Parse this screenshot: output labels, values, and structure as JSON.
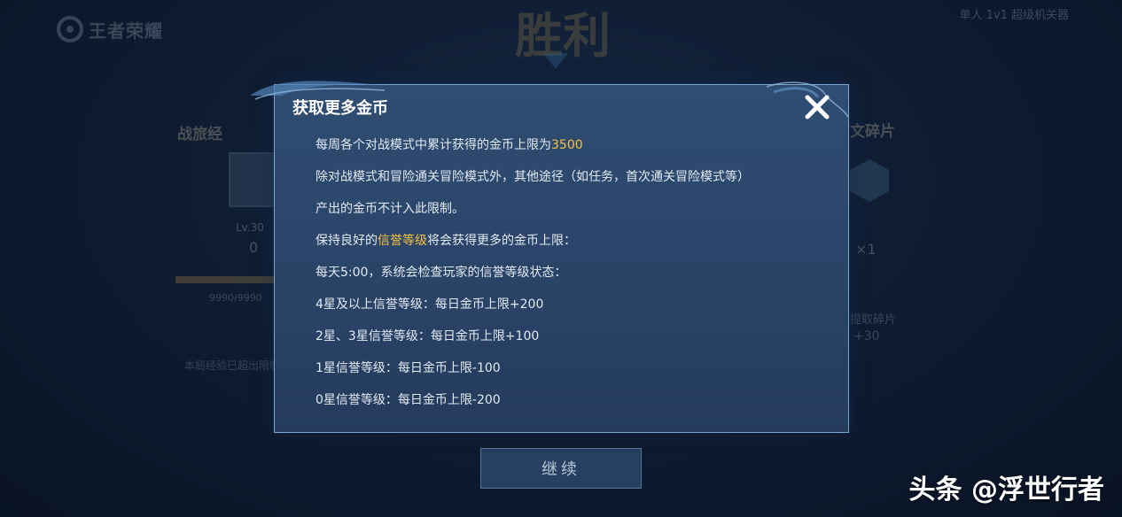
{
  "header": {
    "logo_text": "王者荣耀",
    "victory_text": "胜利",
    "mode_label": "单人 1v1 超级机关器"
  },
  "left_panel": {
    "title": "战旅经",
    "level": "Lv.30",
    "count": "0",
    "exp": "9990/9990",
    "note": "本局经验已超出限制"
  },
  "right_panel": {
    "title": "文碎片",
    "count": "×1",
    "sub_label": "提取碎片",
    "sub_value": "+30"
  },
  "dialog": {
    "title": "获取更多金币",
    "lines": {
      "l1_prefix": "每周各个对战模式中累计获得的金币上限为",
      "l1_value": "3500",
      "l2": "除对战模式和冒险通关冒险模式外，其他途径（如任务，首次通关冒险模式等）",
      "l3": "产出的金币不计入此限制。",
      "l4_prefix": "保持良好的",
      "l4_highlight": "信誉等级",
      "l4_suffix": "将会获得更多的金币上限：",
      "l5": "每天5:00，系统会检查玩家的信誉等级状态：",
      "l6": "4星及以上信誉等级：每日金币上限+200",
      "l7": "2星、3星信誉等级：每日金币上限+100",
      "l8": "1星信誉等级：每日金币上限-100",
      "l9": "0星信誉等级：每日金币上限-200"
    }
  },
  "continue_label": "继续",
  "watermark": "头条 @浮世行者",
  "colors": {
    "highlight": "#f5c242",
    "dialog_border": "#7aa6cf",
    "dialog_bg": "#2a4468"
  }
}
